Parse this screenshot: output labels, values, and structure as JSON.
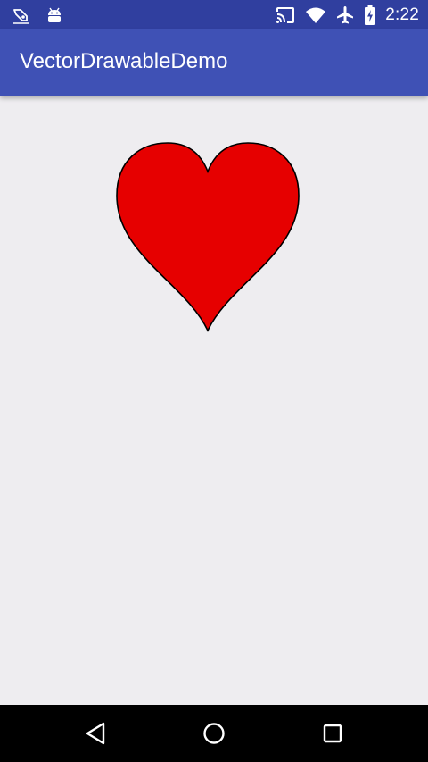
{
  "status_bar": {
    "left_icons": [
      "maps-pin-icon",
      "android-icon"
    ],
    "right_icons": [
      "cast-icon",
      "wifi-icon",
      "airplane-mode-icon",
      "battery-charging-icon"
    ],
    "time": "2:22"
  },
  "app_bar": {
    "title": "VectorDrawableDemo"
  },
  "content": {
    "image": {
      "icon": "heart-icon",
      "fill_color": "#E60000",
      "stroke_color": "#000000"
    }
  },
  "nav_bar": {
    "buttons": [
      "back-icon",
      "home-icon",
      "recents-icon"
    ]
  },
  "colors": {
    "status_bar": "#303F9F",
    "app_bar": "#3F51B5",
    "background": "#EEEDF0",
    "nav_bar": "#000000"
  }
}
